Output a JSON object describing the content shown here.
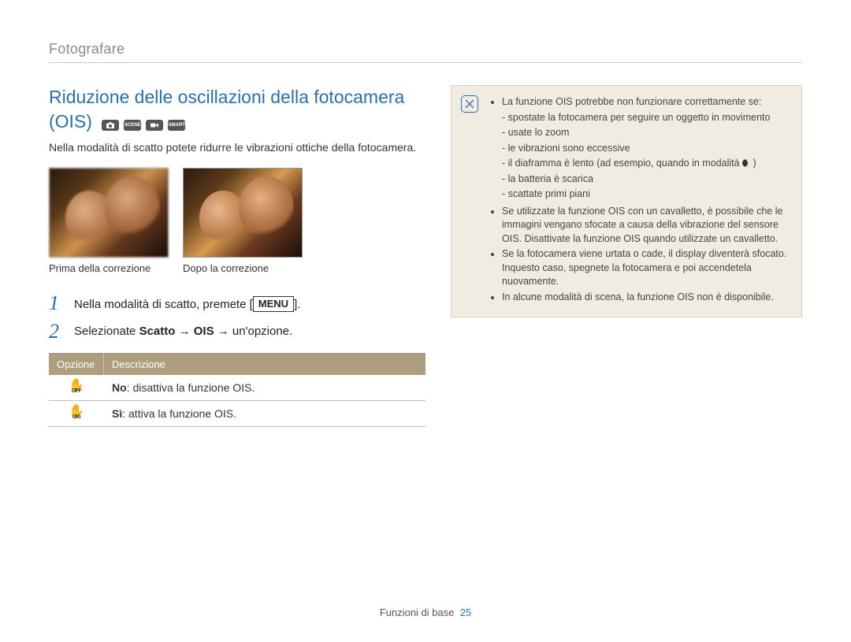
{
  "breadcrumb": "Fotografare",
  "heading_line1": "Riduzione delle oscillazioni della fotocamera",
  "heading_line2": "(OIS)",
  "intro": "Nella modalità di scatto potete ridurre le vibrazioni ottiche della fotocamera.",
  "photo": {
    "before_caption": "Prima della correzione",
    "after_caption": "Dopo la correzione"
  },
  "steps": [
    {
      "num": "1",
      "prefix": "Nella modalità di scatto, premete [",
      "menu": "MENU",
      "suffix": "]."
    },
    {
      "num": "2",
      "prefix": "Selezionate ",
      "b1": "Scatto",
      "mid1": " → ",
      "b2": "OIS",
      "mid2": " → un'opzione."
    }
  ],
  "table": {
    "head_option": "Opzione",
    "head_desc": "Descrizione",
    "rows": [
      {
        "icon_sub": "OFF",
        "bold": "No",
        "rest": ": disattiva la funzione OIS."
      },
      {
        "icon_sub": "OIS",
        "bold": "Sì",
        "rest": ": attiva la funzione OIS."
      }
    ]
  },
  "notes": {
    "b1": "La funzione OIS potrebbe non funzionare correttamente se:",
    "b1_subs": [
      "spostate la fotocamera per seguire un oggetto in movimento",
      "usate lo zoom",
      "le vibrazioni sono eccessive",
      "il diaframma è lento (ad esempio, quando in modalità ",
      "la batteria è scarica",
      "scattate primi piani"
    ],
    "b1_sub4_suffix": " )",
    "b2": "Se utilizzate la funzione OIS con un cavalletto, è possibile che le immagini vengano sfocate a causa della vibrazione del sensore OIS. Disattivate la funzione OIS quando utilizzate un cavalletto.",
    "b3": "Se la fotocamera viene urtata o cade, il display diventerà sfocato. Inquesto caso, spegnete la fotocamera e poi accendetela nuovamente.",
    "b4": "In alcune modalità di scena, la funzione OIS non è disponibile."
  },
  "footer": {
    "section": "Funzioni di base",
    "page": "25"
  }
}
